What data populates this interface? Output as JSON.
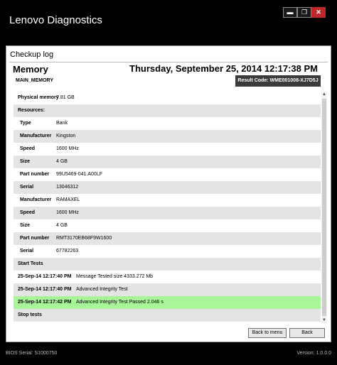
{
  "app": {
    "title": "Lenovo Diagnostics",
    "window_buttons": {
      "minimize": "▬",
      "restore": "❐",
      "close": "✕"
    }
  },
  "panel": {
    "title": "Checkup log",
    "section": "Memory",
    "datetime": "Thursday, September 25, 2014 12:17:38 PM",
    "result_code": "Result Code: WME001008-XJ7D5J",
    "device_id": "MAIN_MEMORY"
  },
  "rows": [
    {
      "type": "kv",
      "key": "Physical memory",
      "value": "7.81 GB",
      "alt": false
    },
    {
      "type": "header",
      "label": "Resources:",
      "alt": true
    },
    {
      "type": "kv_in",
      "key": "Type",
      "value": "Bank",
      "alt": false
    },
    {
      "type": "kv_in",
      "key": "Manufacturer",
      "value": "Kingston",
      "alt": true
    },
    {
      "type": "kv_in",
      "key": "Speed",
      "value": "1600 MHz",
      "alt": false
    },
    {
      "type": "kv_in",
      "key": "Size",
      "value": "4 GB",
      "alt": true
    },
    {
      "type": "kv_in",
      "key": "Part number",
      "value": "99U5469-041.A00LF",
      "alt": false
    },
    {
      "type": "kv_in",
      "key": "Serial",
      "value": "13046312",
      "alt": true
    },
    {
      "type": "kv_in",
      "key": "Manufacturer",
      "value": "RAMAXEL",
      "alt": false
    },
    {
      "type": "kv_in",
      "key": "Speed",
      "value": "1600 MHz",
      "alt": true
    },
    {
      "type": "kv_in",
      "key": "Size",
      "value": "4 GB",
      "alt": false
    },
    {
      "type": "kv_in",
      "key": "Part number",
      "value": "RMT3170EB68F9W1600",
      "alt": true
    },
    {
      "type": "kv_in",
      "key": "Serial",
      "value": "67782263",
      "alt": false
    },
    {
      "type": "header",
      "label": "Start Tests",
      "alt": true
    },
    {
      "type": "log",
      "key": "25-Sep-14 12:17:40 PM",
      "value": "Message Tested size 4333.272 Mb",
      "alt": false
    },
    {
      "type": "log",
      "key": "25-Sep-14 12:17:40 PM",
      "value": "Advanced Integrity Test",
      "alt": true
    },
    {
      "type": "log",
      "key": "25-Sep-14 12:17:42 PM",
      "value": "Advanced Integrity Test Passed 2.046 s",
      "alt": false,
      "pass": true
    },
    {
      "type": "header",
      "label": "Stop tests",
      "alt": true
    }
  ],
  "buttons": {
    "back_to_menu": "Back to menu",
    "back": "Back"
  },
  "scrollbar": {
    "up": "▲",
    "down": "▼"
  },
  "footer": {
    "bios_serial": "BIOS Serial: S1000750",
    "version": "Version: 1.0.0.0"
  },
  "colors": {
    "pass": "#a8f59a",
    "alt_row": "#e4e4e4",
    "close": "#c0272d"
  }
}
